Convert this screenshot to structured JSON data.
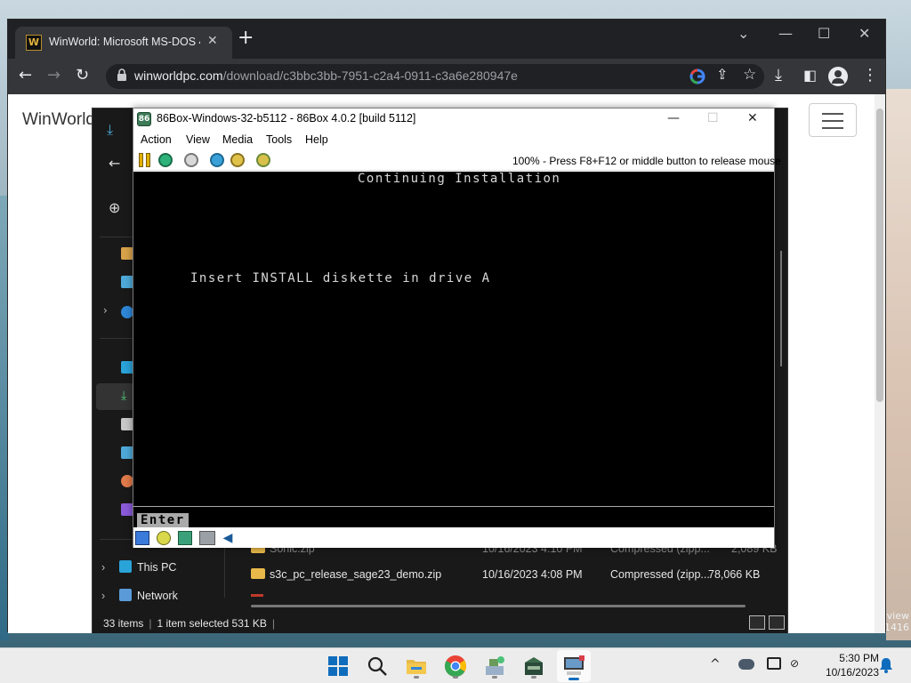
{
  "desktop": {
    "wallpaper_text": [
      "view",
      "1416"
    ]
  },
  "chrome": {
    "tab_title": "WinWorld: Microsoft MS-DOS 4",
    "url_host": "winworldpc.com",
    "url_path": "/download/c3bbc3bb-7951-c2a4-0911-c3a6e280947e",
    "page_brand": "WinWorld"
  },
  "explorer": {
    "nav": {
      "this_pc": "This PC",
      "network": "Network"
    },
    "files": [
      {
        "name": "Sonic.zip",
        "date": "10/16/2023 4:10 PM",
        "type": "Compressed (zipp...",
        "size": "2,089 KB"
      },
      {
        "name": "s3c_pc_release_sage23_demo.zip",
        "date": "10/16/2023 4:08 PM",
        "type": "Compressed (zipp...",
        "size": "78,066 KB"
      }
    ],
    "status": {
      "count": "33 items",
      "selected": "1 item selected",
      "size": "531 KB"
    },
    "colors": {
      "folder": "#e8b94a",
      "accent": "#4ea9d9"
    }
  },
  "emulator": {
    "title": "86Box-Windows-32-b5112 - 86Box 4.0.2 [build 5112]",
    "menu": [
      "Action",
      "View",
      "Media",
      "Tools",
      "Help"
    ],
    "release_hint": "100% - Press F8+F12 or middle button to release mouse",
    "screen": {
      "header": "Continuing Installation",
      "prompt": "Insert INSTALL diskette in drive A",
      "key": "Enter"
    }
  },
  "taskbar": {
    "time": "5:30 PM",
    "date": "10/16/2023"
  }
}
